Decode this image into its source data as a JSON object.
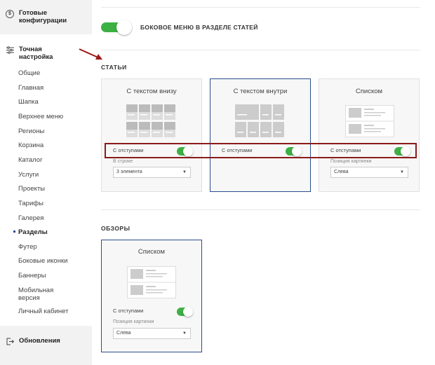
{
  "sidebar": {
    "ready_configs": "Готовые конфигурации",
    "fine_tuning": "Точная настройка",
    "items": [
      {
        "label": "Общие",
        "active": false
      },
      {
        "label": "Главная",
        "active": false
      },
      {
        "label": "Шапка",
        "active": false
      },
      {
        "label": "Верхнее меню",
        "active": false
      },
      {
        "label": "Регионы",
        "active": false
      },
      {
        "label": "Корзина",
        "active": false
      },
      {
        "label": "Каталог",
        "active": false
      },
      {
        "label": "Услуги",
        "active": false
      },
      {
        "label": "Проекты",
        "active": false
      },
      {
        "label": "Тарифы",
        "active": false
      },
      {
        "label": "Галерея",
        "active": false
      },
      {
        "label": "Разделы",
        "active": true
      },
      {
        "label": "Футер",
        "active": false
      },
      {
        "label": "Боковые иконки",
        "active": false
      },
      {
        "label": "Баннеры",
        "active": false
      },
      {
        "label": "Мобильная версия",
        "active": false
      },
      {
        "label": "Личный кабинет",
        "active": false
      }
    ],
    "updates": "Обновления"
  },
  "main": {
    "side_menu_toggle": {
      "label": "БОКОВОЕ МЕНЮ В РАЗДЕЛЕ СТАТЕЙ",
      "on": true
    },
    "articles": {
      "title": "СТАТЬИ",
      "cards": [
        {
          "title": "С текстом внизу",
          "option_label": "С отступами",
          "option_on": true,
          "sub_label": "В строке",
          "select_value": "3 элемента",
          "selected": false
        },
        {
          "title": "С текстом внутри",
          "option_label": "С отступами",
          "option_on": true,
          "selected": true
        },
        {
          "title": "Списком",
          "option_label": "С отступами",
          "option_on": true,
          "sub_label": "Позиция картинки",
          "select_value": "Слева",
          "selected": false
        }
      ]
    },
    "reviews": {
      "title": "ОБЗОРЫ",
      "cards": [
        {
          "title": "Списком",
          "option_label": "С отступами",
          "option_on": true,
          "sub_label": "Позиция картинки",
          "select_value": "Слева",
          "selected": true
        }
      ]
    }
  },
  "colors": {
    "toggle_on": "#3cb043",
    "selected_border": "#2a4d8f",
    "highlight": "#8b1a1a"
  }
}
